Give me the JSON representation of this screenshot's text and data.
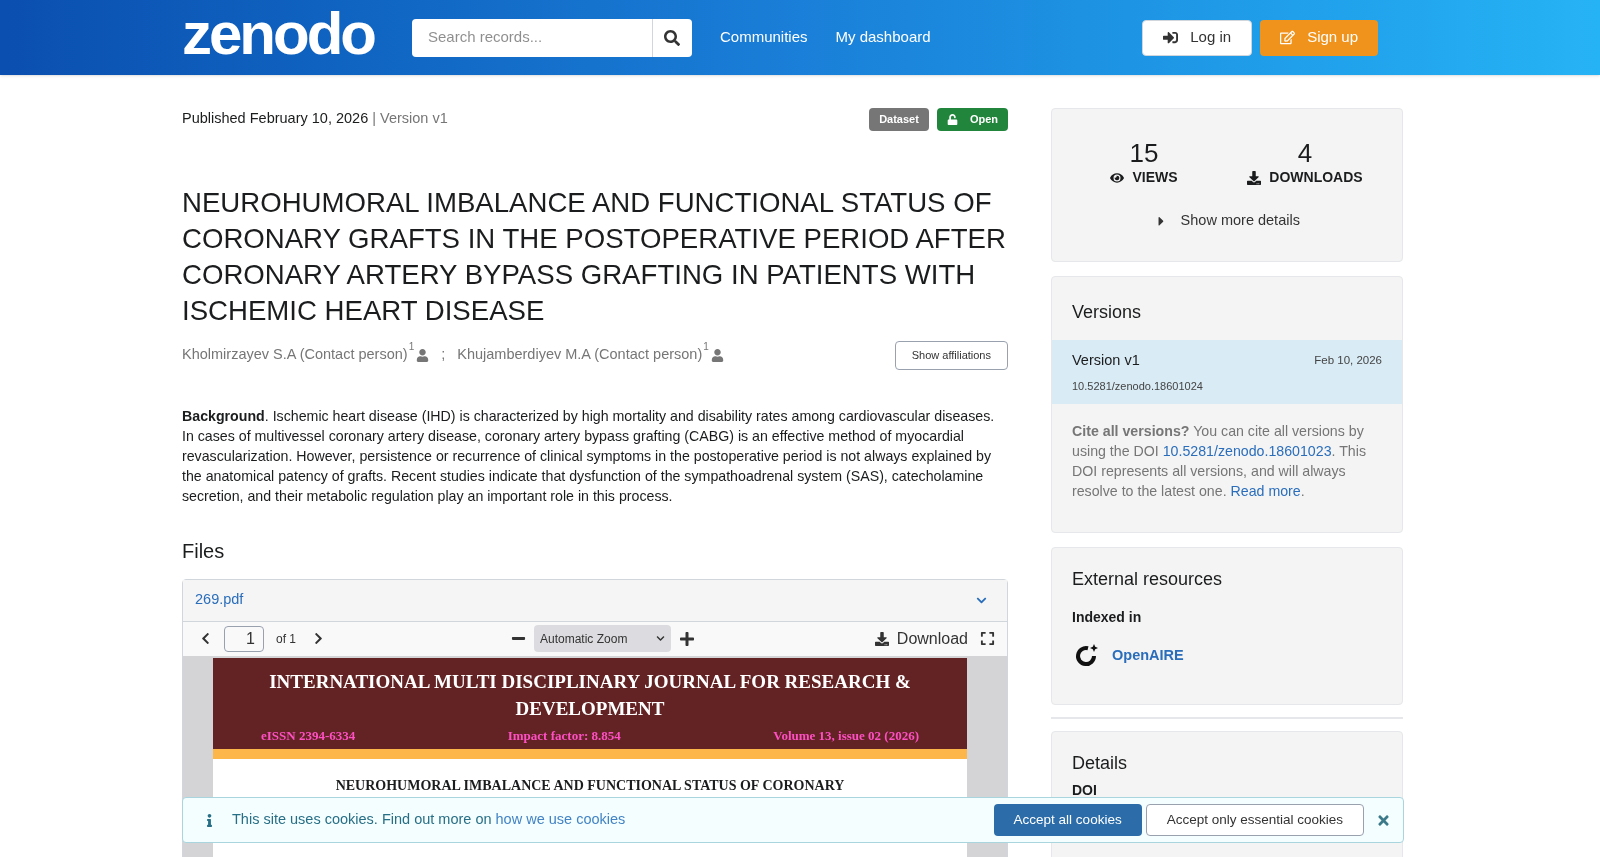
{
  "header": {
    "logo": "zenodo",
    "search": {
      "placeholder": "Search records..."
    },
    "nav": [
      "Communities",
      "My dashboard"
    ],
    "login": "Log in",
    "signup": "Sign up"
  },
  "record": {
    "published": "Published February 10, 2026",
    "version": "| Version v1",
    "badges": [
      {
        "label": "Dataset",
        "kind": "type"
      },
      {
        "label": "Open",
        "kind": "access"
      }
    ],
    "title": "NEUROHUMORAL IMBALANCE AND FUNCTIONAL STATUS OF CORONARY GRAFTS IN THE POSTOPERATIVE PERIOD AFTER CORONARY ARTERY BYPASS GRAFTING IN PATIENTS WITH ISCHEMIC HEART DISEASE",
    "creators": [
      {
        "name": "Kholmirzayev S.A (Contact person)",
        "sup": "1"
      },
      {
        "name": "Khujamberdiyev M.A (Contact person)",
        "sup": "1"
      }
    ],
    "separator": ";",
    "show_affiliations": "Show affiliations",
    "abstract": "**Background**. Ischemic heart disease (IHD) is characterized by high mortality and disability rates among cardiovascular diseases. In cases of multivessel coronary artery disease, coronary artery bypass grafting (CABG) is an effective method of myocardial revascularization. However, persistence or recurrence of clinical symptoms in the postoperative period is not always explained by the anatomical patency of grafts. Recent studies indicate that dysfunction of the sympathoadrenal system (SAS), catecholamine secretion, and their metabolic regulation play an important role in this process."
  },
  "files": {
    "heading": "Files",
    "file_name": "269.pdf",
    "viewer": {
      "page": "1",
      "page_count": "of 1",
      "zoom": "Automatic Zoom",
      "download": "Download",
      "journal_title": "INTERNATIONAL MULTI DISCIPLINARY JOURNAL FOR RESEARCH & DEVELOPMENT",
      "eissn": "eISSN 2394-6334",
      "impact": "Impact factor: 8.854",
      "volume": "Volume 13, issue 02 (2026)",
      "paper_title": "NEUROHUMORAL IMBALANCE AND FUNCTIONAL STATUS OF CORONARY"
    }
  },
  "stats": {
    "views": "15",
    "views_label": "VIEWS",
    "downloads": "4",
    "downloads_label": "DOWNLOADS",
    "more": "Show more details"
  },
  "versions": {
    "heading": "Versions",
    "items": [
      {
        "label": "Version v1",
        "date": "Feb 10, 2026",
        "doi": "10.5281/zenodo.18601024",
        "selected": true
      }
    ],
    "cite_bold": "Cite all versions?",
    "cite_text": "You can cite all versions by using the DOI",
    "cite_doi": "10.5281/zenodo.18601023",
    "cite_rest": ". This DOI represents all versions, and will always resolve to the latest one.",
    "read_more": "Read more",
    "period": "."
  },
  "external": {
    "heading": "External resources",
    "indexed": "Indexed in",
    "source": "OpenAIRE"
  },
  "details": {
    "heading": "Details",
    "doi_label": "DOI"
  },
  "cookies": {
    "text": "This site uses cookies. Find out more on",
    "link": "how we use cookies",
    "accept_all": "Accept all cookies",
    "accept_essential": "Accept only essential cookies"
  }
}
